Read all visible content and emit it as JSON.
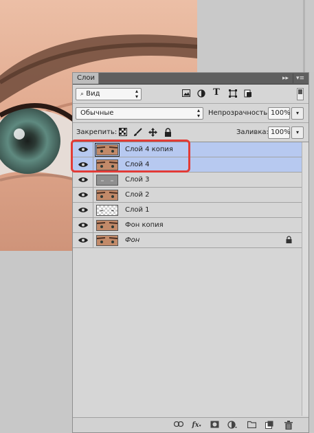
{
  "panel": {
    "tab_label": "Слои",
    "collapse_label": "▸▸",
    "menu_label": "▾≡"
  },
  "filter": {
    "kind_value": "Вид",
    "search_icon": "search-icon"
  },
  "blend": {
    "mode_value": "Обычные",
    "opacity_label": "Непрозрачность:",
    "opacity_value": "100%"
  },
  "lock": {
    "label": "Закрепить:",
    "fill_label": "Заливка:",
    "fill_value": "100%"
  },
  "layers": [
    {
      "name": "Слой 4 копия",
      "thumb": "face",
      "selected": true
    },
    {
      "name": "Слой 4",
      "thumb": "face",
      "selected": true
    },
    {
      "name": "Слой 3",
      "thumb": "gray",
      "selected": false
    },
    {
      "name": "Слой 2",
      "thumb": "face",
      "selected": false
    },
    {
      "name": "Слой 1",
      "thumb": "trans",
      "selected": false
    },
    {
      "name": "Фон копия",
      "thumb": "face",
      "selected": false
    },
    {
      "name": "Фон",
      "thumb": "face",
      "selected": false,
      "locked": true
    }
  ],
  "colors": {
    "highlight": "#e23b36",
    "selected_row": "#b7c9f0"
  }
}
